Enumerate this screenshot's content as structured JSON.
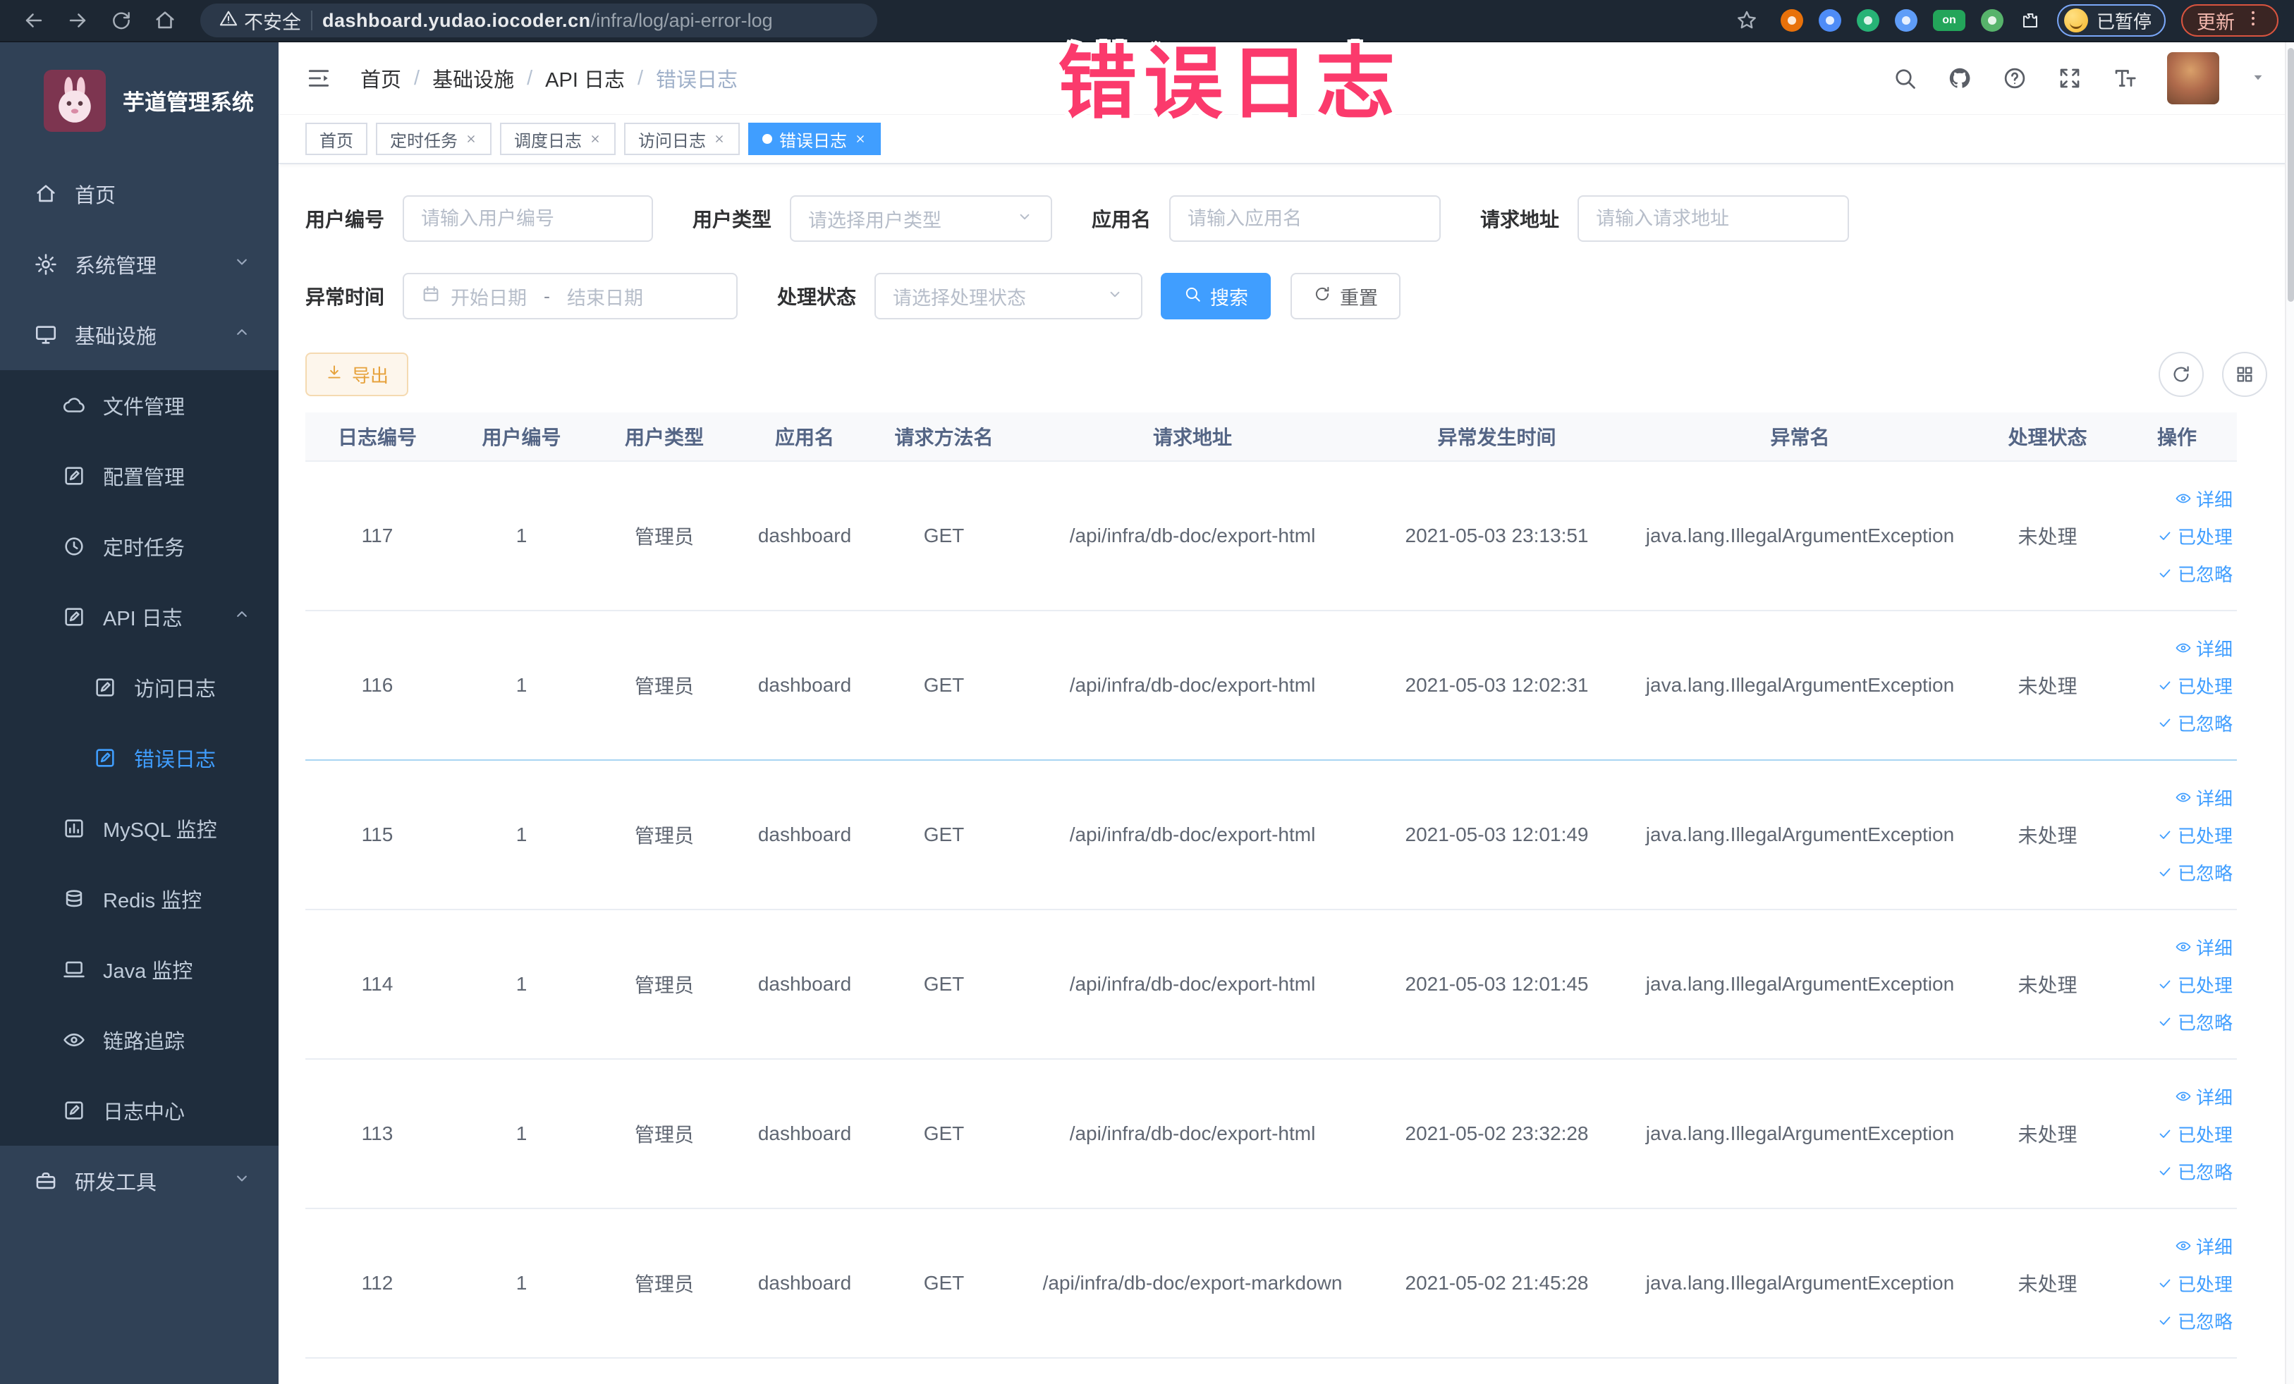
{
  "colors": {
    "accent": "#409eff",
    "warning": "#e6a23c",
    "overlay_pink": "#fb3a6c",
    "sidebar_bg": "#304156",
    "submenu_bg": "#1f2d3d"
  },
  "overlay": {
    "text": "错误日志"
  },
  "browser": {
    "security_text": "不安全",
    "url_host": "dashboard.yudao.iocoder.cn",
    "url_path": "/infra/log/api-error-log",
    "paused_label": "已暂停",
    "update_label": "更新",
    "extensions": [
      {
        "name": "adblock-icon",
        "color": "#e8710a"
      },
      {
        "name": "shield-icon",
        "color": "#4e8cf7"
      },
      {
        "name": "green-check-icon",
        "color": "#27b376"
      },
      {
        "name": "grid-icon",
        "color": "#5f9df8"
      },
      {
        "name": "switch-on-icon",
        "color": "#23a55a",
        "text": "on"
      },
      {
        "name": "leaf-icon",
        "color": "#57b36b"
      },
      {
        "name": "puzzle-icon",
        "color": "#e9edf2"
      }
    ]
  },
  "sidebar": {
    "title": "芋道管理系统",
    "items": [
      {
        "label": "首页",
        "icon": "home",
        "level": 1
      },
      {
        "label": "系统管理",
        "icon": "gear",
        "level": 1,
        "arrow": "down"
      },
      {
        "label": "基础设施",
        "icon": "infra",
        "level": 1,
        "arrow": "up"
      },
      {
        "label": "文件管理",
        "icon": "cloud",
        "level": 2
      },
      {
        "label": "配置管理",
        "icon": "edit",
        "level": 2
      },
      {
        "label": "定时任务",
        "icon": "clock",
        "level": 2
      },
      {
        "label": "API 日志",
        "icon": "log",
        "level": 2,
        "arrow": "up"
      },
      {
        "label": "访问日志",
        "icon": "log",
        "level": 3
      },
      {
        "label": "错误日志",
        "icon": "log",
        "level": 3,
        "active": true
      },
      {
        "label": "MySQL 监控",
        "icon": "chart",
        "level": 2
      },
      {
        "label": "Redis 监控",
        "icon": "redis",
        "level": 2
      },
      {
        "label": "Java 监控",
        "icon": "java",
        "level": 2
      },
      {
        "label": "链路追踪",
        "icon": "eye",
        "level": 2
      },
      {
        "label": "日志中心",
        "icon": "log",
        "level": 2
      },
      {
        "label": "研发工具",
        "icon": "briefcase",
        "level": 1,
        "arrow": "down"
      }
    ]
  },
  "breadcrumb": [
    "首页",
    "基础设施",
    "API 日志",
    "错误日志"
  ],
  "header_icons": [
    "search",
    "github",
    "help",
    "fullscreen",
    "fontsize"
  ],
  "tabs": [
    {
      "label": "首页",
      "closable": false,
      "active": false
    },
    {
      "label": "定时任务",
      "closable": true,
      "active": false
    },
    {
      "label": "调度日志",
      "closable": true,
      "active": false
    },
    {
      "label": "访问日志",
      "closable": true,
      "active": false
    },
    {
      "label": "错误日志",
      "closable": true,
      "active": true
    }
  ],
  "filters": {
    "user_id": {
      "label": "用户编号",
      "placeholder": "请输入用户编号"
    },
    "user_type": {
      "label": "用户类型",
      "placeholder": "请选择用户类型"
    },
    "app_name": {
      "label": "应用名",
      "placeholder": "请输入应用名"
    },
    "request_url": {
      "label": "请求地址",
      "placeholder": "请输入请求地址"
    },
    "exception_time": {
      "label": "异常时间",
      "start_placeholder": "开始日期",
      "separator": "-",
      "end_placeholder": "结束日期"
    },
    "process_status": {
      "label": "处理状态",
      "placeholder": "请选择处理状态"
    },
    "search_label": "搜索",
    "reset_label": "重置"
  },
  "toolbar": {
    "export_label": "导出"
  },
  "table": {
    "headers": [
      "日志编号",
      "用户编号",
      "用户类型",
      "应用名",
      "请求方法名",
      "请求地址",
      "异常发生时间",
      "异常名",
      "处理状态",
      "操作"
    ],
    "row_actions": [
      {
        "label": "详细",
        "icon": "eye"
      },
      {
        "label": "已处理",
        "icon": "check"
      },
      {
        "label": "已忽略",
        "icon": "check"
      }
    ],
    "rows": [
      {
        "id": "117",
        "user_id": "1",
        "user_type": "管理员",
        "app_name": "dashboard",
        "method": "GET",
        "url": "/api/infra/db-doc/export-html",
        "time": "2021-05-03 23:13:51",
        "exception": "java.lang.IllegalArgumentException",
        "status": "未处理"
      },
      {
        "id": "116",
        "user_id": "1",
        "user_type": "管理员",
        "app_name": "dashboard",
        "method": "GET",
        "url": "/api/infra/db-doc/export-html",
        "time": "2021-05-03 12:02:31",
        "exception": "java.lang.IllegalArgumentException",
        "status": "未处理"
      },
      {
        "id": "115",
        "user_id": "1",
        "user_type": "管理员",
        "app_name": "dashboard",
        "method": "GET",
        "url": "/api/infra/db-doc/export-html",
        "time": "2021-05-03 12:01:49",
        "exception": "java.lang.IllegalArgumentException",
        "status": "未处理"
      },
      {
        "id": "114",
        "user_id": "1",
        "user_type": "管理员",
        "app_name": "dashboard",
        "method": "GET",
        "url": "/api/infra/db-doc/export-html",
        "time": "2021-05-03 12:01:45",
        "exception": "java.lang.IllegalArgumentException",
        "status": "未处理"
      },
      {
        "id": "113",
        "user_id": "1",
        "user_type": "管理员",
        "app_name": "dashboard",
        "method": "GET",
        "url": "/api/infra/db-doc/export-html",
        "time": "2021-05-02 23:32:28",
        "exception": "java.lang.IllegalArgumentException",
        "status": "未处理"
      },
      {
        "id": "112",
        "user_id": "1",
        "user_type": "管理员",
        "app_name": "dashboard",
        "method": "GET",
        "url": "/api/infra/db-doc/export-markdown",
        "time": "2021-05-02 21:45:28",
        "exception": "java.lang.IllegalArgumentException",
        "status": "未处理"
      }
    ]
  }
}
